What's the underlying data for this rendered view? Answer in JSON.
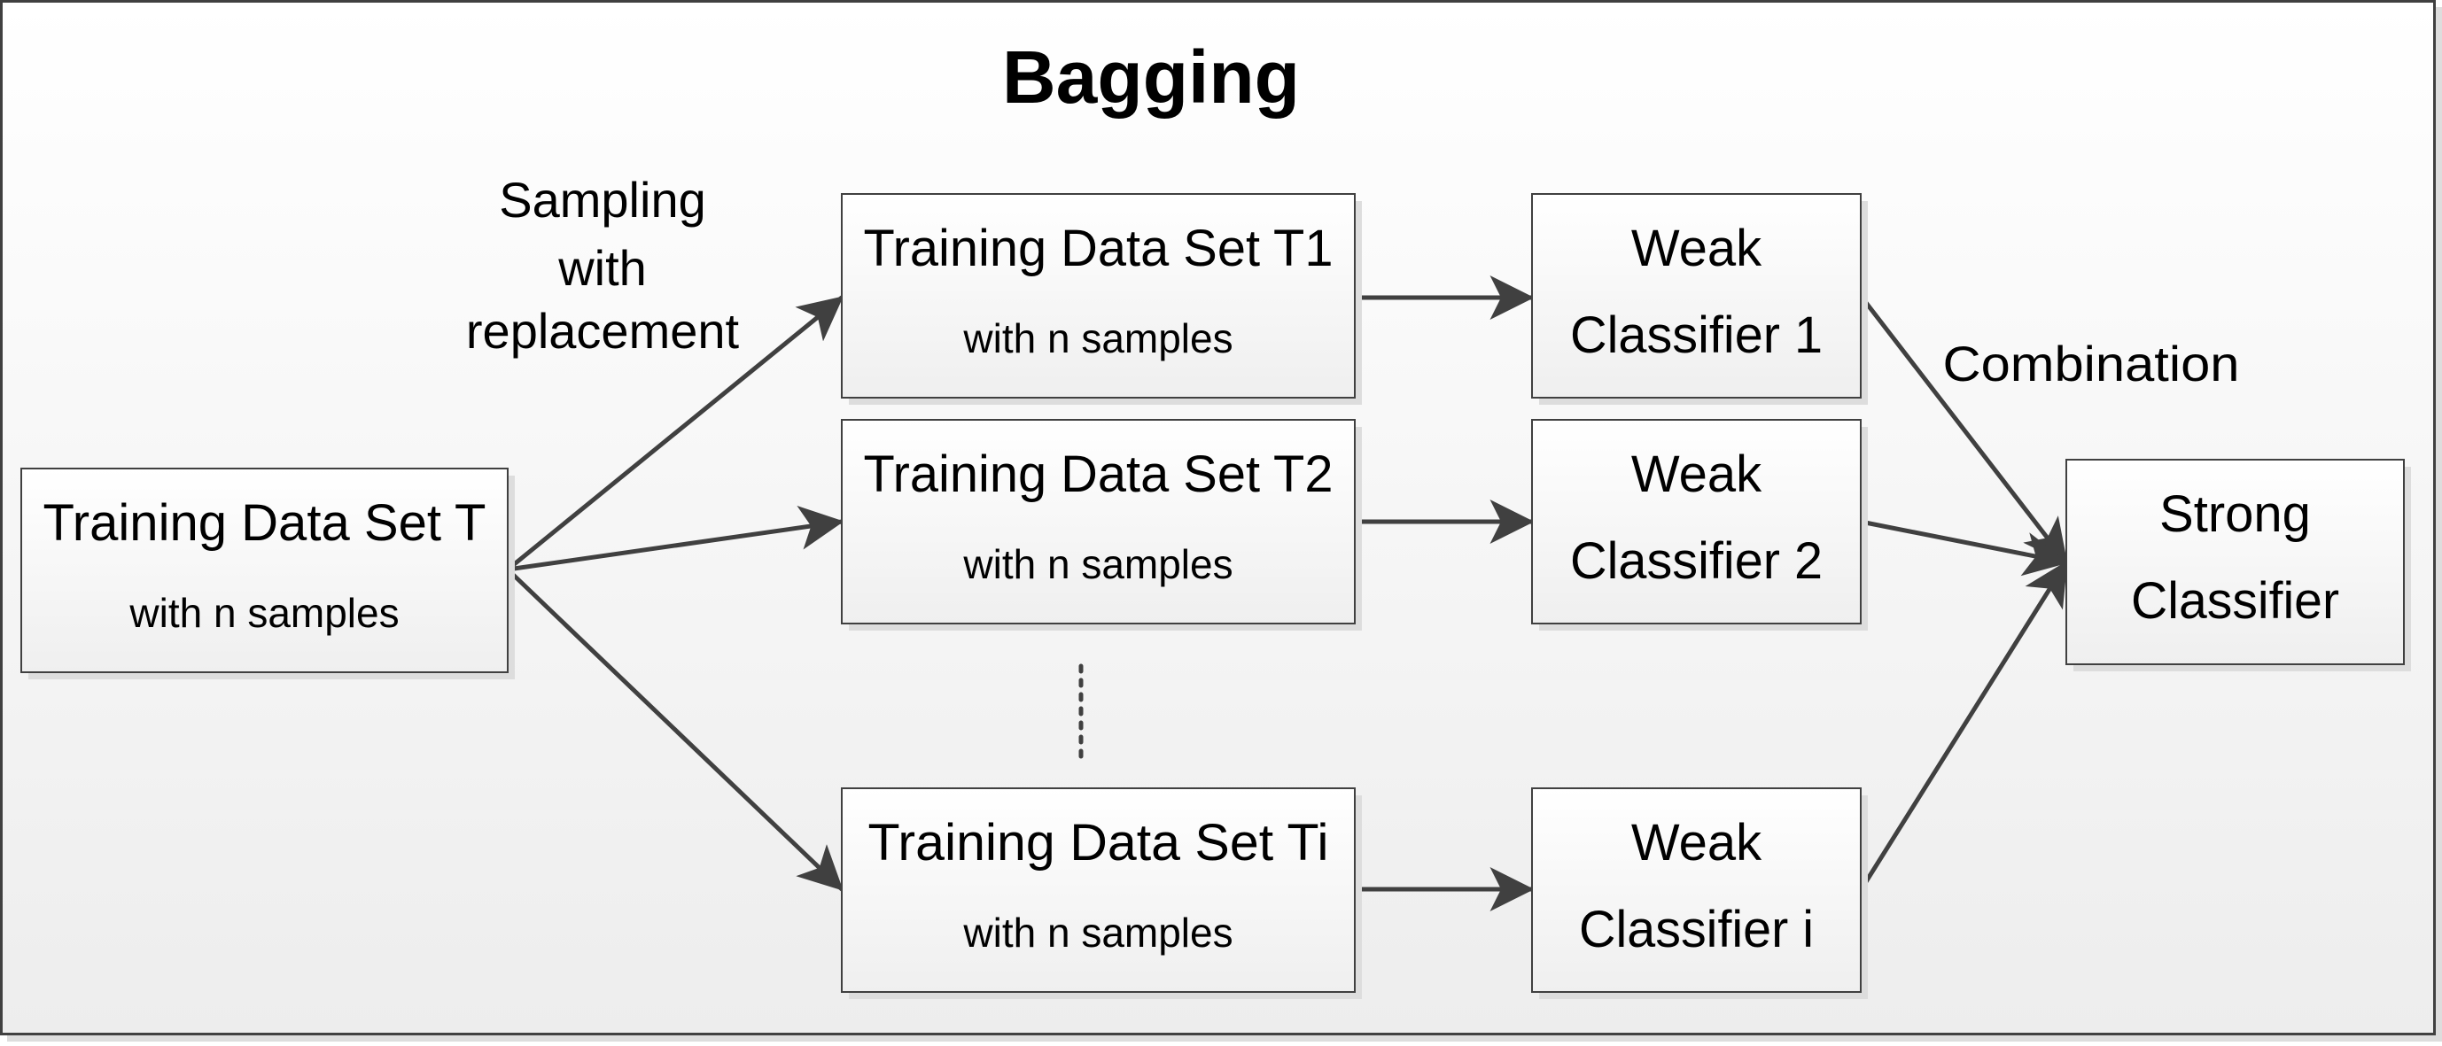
{
  "title": "Bagging",
  "colors": {
    "border": "#404040",
    "arrow": "#404040",
    "shadow": "#dddddd",
    "box_fill_top": "#ffffff",
    "box_fill_bottom": "#efefef",
    "background_top": "#ffffff",
    "background_bottom": "#ededed",
    "text": "#000000"
  },
  "labels": {
    "sampling": [
      "Sampling",
      "with",
      "replacement"
    ],
    "combination": "Combination",
    "ellipsis": "vertical-dotted-ellipsis"
  },
  "nodes": {
    "source": {
      "line1": "Training Data Set T",
      "line2": "with n samples"
    },
    "subsets": [
      {
        "line1": "Training Data Set T1",
        "line2": "with n samples"
      },
      {
        "line1": "Training Data Set T2",
        "line2": "with n samples"
      },
      {
        "line1": "Training Data Set Ti",
        "line2": "with n samples"
      }
    ],
    "weak": [
      {
        "line1": "Weak",
        "line2": "Classifier 1"
      },
      {
        "line1": "Weak",
        "line2": "Classifier 2"
      },
      {
        "line1": "Weak",
        "line2": "Classifier i"
      }
    ],
    "strong": {
      "line1": "Strong",
      "line2": "Classifier"
    }
  },
  "edges": [
    {
      "from": "source",
      "to": "subset-1"
    },
    {
      "from": "source",
      "to": "subset-2"
    },
    {
      "from": "source",
      "to": "subset-i"
    },
    {
      "from": "subset-1",
      "to": "weak-1"
    },
    {
      "from": "subset-2",
      "to": "weak-2"
    },
    {
      "from": "subset-i",
      "to": "weak-i"
    },
    {
      "from": "weak-1",
      "to": "strong"
    },
    {
      "from": "weak-2",
      "to": "strong"
    },
    {
      "from": "weak-i",
      "to": "strong"
    }
  ]
}
